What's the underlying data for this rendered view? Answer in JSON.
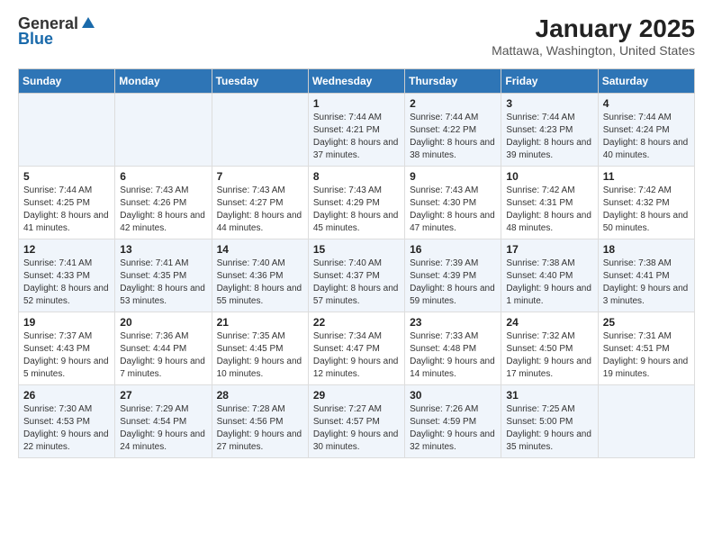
{
  "logo": {
    "general": "General",
    "blue": "Blue"
  },
  "title": "January 2025",
  "subtitle": "Mattawa, Washington, United States",
  "days_of_week": [
    "Sunday",
    "Monday",
    "Tuesday",
    "Wednesday",
    "Thursday",
    "Friday",
    "Saturday"
  ],
  "weeks": [
    [
      {
        "day": "",
        "text": ""
      },
      {
        "day": "",
        "text": ""
      },
      {
        "day": "",
        "text": ""
      },
      {
        "day": "1",
        "text": "Sunrise: 7:44 AM\nSunset: 4:21 PM\nDaylight: 8 hours and 37 minutes."
      },
      {
        "day": "2",
        "text": "Sunrise: 7:44 AM\nSunset: 4:22 PM\nDaylight: 8 hours and 38 minutes."
      },
      {
        "day": "3",
        "text": "Sunrise: 7:44 AM\nSunset: 4:23 PM\nDaylight: 8 hours and 39 minutes."
      },
      {
        "day": "4",
        "text": "Sunrise: 7:44 AM\nSunset: 4:24 PM\nDaylight: 8 hours and 40 minutes."
      }
    ],
    [
      {
        "day": "5",
        "text": "Sunrise: 7:44 AM\nSunset: 4:25 PM\nDaylight: 8 hours and 41 minutes."
      },
      {
        "day": "6",
        "text": "Sunrise: 7:43 AM\nSunset: 4:26 PM\nDaylight: 8 hours and 42 minutes."
      },
      {
        "day": "7",
        "text": "Sunrise: 7:43 AM\nSunset: 4:27 PM\nDaylight: 8 hours and 44 minutes."
      },
      {
        "day": "8",
        "text": "Sunrise: 7:43 AM\nSunset: 4:29 PM\nDaylight: 8 hours and 45 minutes."
      },
      {
        "day": "9",
        "text": "Sunrise: 7:43 AM\nSunset: 4:30 PM\nDaylight: 8 hours and 47 minutes."
      },
      {
        "day": "10",
        "text": "Sunrise: 7:42 AM\nSunset: 4:31 PM\nDaylight: 8 hours and 48 minutes."
      },
      {
        "day": "11",
        "text": "Sunrise: 7:42 AM\nSunset: 4:32 PM\nDaylight: 8 hours and 50 minutes."
      }
    ],
    [
      {
        "day": "12",
        "text": "Sunrise: 7:41 AM\nSunset: 4:33 PM\nDaylight: 8 hours and 52 minutes."
      },
      {
        "day": "13",
        "text": "Sunrise: 7:41 AM\nSunset: 4:35 PM\nDaylight: 8 hours and 53 minutes."
      },
      {
        "day": "14",
        "text": "Sunrise: 7:40 AM\nSunset: 4:36 PM\nDaylight: 8 hours and 55 minutes."
      },
      {
        "day": "15",
        "text": "Sunrise: 7:40 AM\nSunset: 4:37 PM\nDaylight: 8 hours and 57 minutes."
      },
      {
        "day": "16",
        "text": "Sunrise: 7:39 AM\nSunset: 4:39 PM\nDaylight: 8 hours and 59 minutes."
      },
      {
        "day": "17",
        "text": "Sunrise: 7:38 AM\nSunset: 4:40 PM\nDaylight: 9 hours and 1 minute."
      },
      {
        "day": "18",
        "text": "Sunrise: 7:38 AM\nSunset: 4:41 PM\nDaylight: 9 hours and 3 minutes."
      }
    ],
    [
      {
        "day": "19",
        "text": "Sunrise: 7:37 AM\nSunset: 4:43 PM\nDaylight: 9 hours and 5 minutes."
      },
      {
        "day": "20",
        "text": "Sunrise: 7:36 AM\nSunset: 4:44 PM\nDaylight: 9 hours and 7 minutes."
      },
      {
        "day": "21",
        "text": "Sunrise: 7:35 AM\nSunset: 4:45 PM\nDaylight: 9 hours and 10 minutes."
      },
      {
        "day": "22",
        "text": "Sunrise: 7:34 AM\nSunset: 4:47 PM\nDaylight: 9 hours and 12 minutes."
      },
      {
        "day": "23",
        "text": "Sunrise: 7:33 AM\nSunset: 4:48 PM\nDaylight: 9 hours and 14 minutes."
      },
      {
        "day": "24",
        "text": "Sunrise: 7:32 AM\nSunset: 4:50 PM\nDaylight: 9 hours and 17 minutes."
      },
      {
        "day": "25",
        "text": "Sunrise: 7:31 AM\nSunset: 4:51 PM\nDaylight: 9 hours and 19 minutes."
      }
    ],
    [
      {
        "day": "26",
        "text": "Sunrise: 7:30 AM\nSunset: 4:53 PM\nDaylight: 9 hours and 22 minutes."
      },
      {
        "day": "27",
        "text": "Sunrise: 7:29 AM\nSunset: 4:54 PM\nDaylight: 9 hours and 24 minutes."
      },
      {
        "day": "28",
        "text": "Sunrise: 7:28 AM\nSunset: 4:56 PM\nDaylight: 9 hours and 27 minutes."
      },
      {
        "day": "29",
        "text": "Sunrise: 7:27 AM\nSunset: 4:57 PM\nDaylight: 9 hours and 30 minutes."
      },
      {
        "day": "30",
        "text": "Sunrise: 7:26 AM\nSunset: 4:59 PM\nDaylight: 9 hours and 32 minutes."
      },
      {
        "day": "31",
        "text": "Sunrise: 7:25 AM\nSunset: 5:00 PM\nDaylight: 9 hours and 35 minutes."
      },
      {
        "day": "",
        "text": ""
      }
    ]
  ]
}
